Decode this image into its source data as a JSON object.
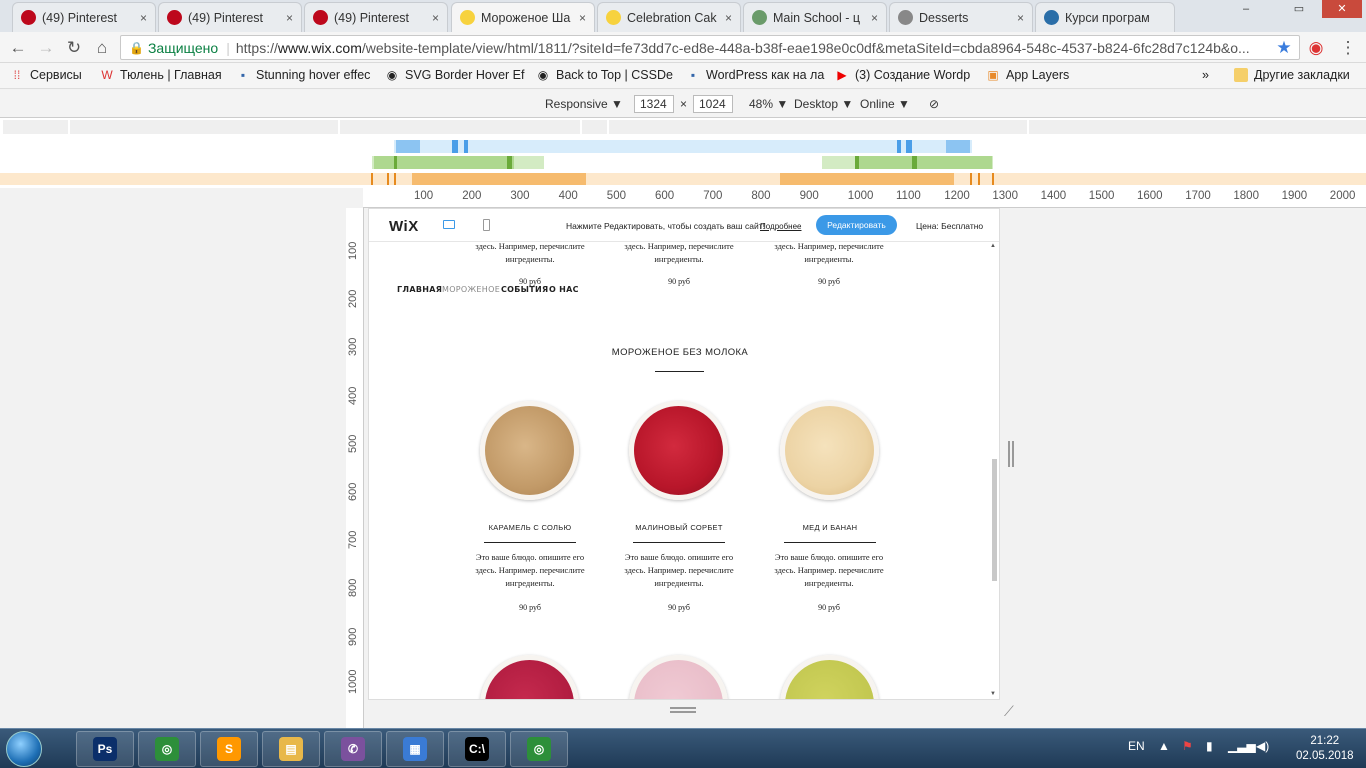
{
  "browser": {
    "tabs": [
      {
        "title": "(49) Pinterest",
        "icon": "pinterest-icon",
        "color": "#bd081c",
        "active": false
      },
      {
        "title": "(49) Pinterest",
        "icon": "pinterest-icon",
        "color": "#bd081c",
        "active": false
      },
      {
        "title": "(49) Pinterest",
        "icon": "pinterest-icon",
        "color": "#bd081c",
        "active": false
      },
      {
        "title": "Мороженое Ша",
        "icon": "wix-icon",
        "color": "#f7d23e",
        "active": true
      },
      {
        "title": "Celebration Cak",
        "icon": "wix-icon",
        "color": "#f7d23e",
        "active": false
      },
      {
        "title": "Main School - ц",
        "icon": "globe-icon",
        "color": "#6a9b6a",
        "active": false
      },
      {
        "title": "Desserts",
        "icon": "page-icon",
        "color": "#888888",
        "active": false
      },
      {
        "title": "Курси програм",
        "icon": "globe-icon",
        "color": "#2a6ea8",
        "active": false
      }
    ],
    "close_glyph": "×",
    "address": {
      "secure_label": "Защищено",
      "url_scheme": "https://",
      "url_host": "www.wix.com",
      "url_path": "/website-template/view/html/1811/?siteId=fe73dd7c-ed8e-448a-b38f-eae198e0c0df&metaSiteId=cbda8964-548c-4537-b824-6fc28d7c124b&o..."
    },
    "bookmarks": [
      {
        "label": "Сервисы",
        "icon": "apps-icon"
      },
      {
        "label": "Тюлень | Главная",
        "icon": "w-icon"
      },
      {
        "label": "Stunning hover effec",
        "icon": "page-icon"
      },
      {
        "label": "SVG Border Hover Ef",
        "icon": "codepen-icon"
      },
      {
        "label": "Back to Top | CSSDe",
        "icon": "codepen-icon"
      },
      {
        "label": "WordPress как на ла",
        "icon": "page-icon"
      },
      {
        "label": "(3) Создание Wordp",
        "icon": "youtube-icon"
      },
      {
        "label": "App Layers",
        "icon": "app-layers-icon"
      }
    ],
    "bookmarks_more": "»",
    "other_bookmarks": "Другие закладки"
  },
  "devtools": {
    "mode": "Responsive",
    "width": "1324",
    "times": "×",
    "height": "1024",
    "zoom": "48%",
    "device": "Desktop",
    "network": "Online",
    "ruler_ticks": [
      "100",
      "200",
      "300",
      "400",
      "500",
      "600",
      "700",
      "800",
      "900",
      "1000",
      "1100",
      "1200",
      "1300",
      "1400",
      "1500",
      "1600",
      "1700",
      "1800",
      "1900",
      "2000"
    ],
    "vruler_ticks": [
      "100",
      "200",
      "300",
      "400",
      "500",
      "600",
      "700",
      "800",
      "900",
      "1000"
    ]
  },
  "wix": {
    "logo": "WiX",
    "message": "Нажмите Редактировать, чтобы создать ваш сайт!",
    "more": "Подробнее",
    "edit_button": "Редактировать",
    "price": "Цена: Бесплатно"
  },
  "site": {
    "nav": [
      "ГЛАВНАЯ",
      "МОРОЖЕНОЕ",
      "СОБЫТИЯ",
      "О НАС"
    ],
    "top_captions": [
      "здесь. Например, перечислите ингредиенты.",
      "здесь. Например, перечислите ингредиенты.",
      "здесь. Например, перечислите ингредиенты."
    ],
    "top_prices": [
      "90 руб",
      "90 руб",
      "90 руб"
    ],
    "section_title": "МОРОЖЕНОЕ БЕЗ МОЛОКА",
    "products": [
      {
        "name": "КАРАМЕЛЬ С СОЛЬЮ",
        "desc": "Это ваше блюдо. опишите его здесь. Например. перечислите ингредиенты.",
        "price": "90 руб",
        "color": "#c9a373"
      },
      {
        "name": "МАЛИНОВЫЙ СОРБЕТ",
        "desc": "Это ваше блюдо. опишите его здесь. Например. перечислите ингредиенты.",
        "price": "90 руб",
        "color": "#b8162a"
      },
      {
        "name": "МЕД И БАНАН",
        "desc": "Это ваше блюдо. опишите его здесь. Например. перечислите ингредиенты.",
        "price": "90 руб",
        "color": "#ecd3a4"
      }
    ],
    "next_row_colors": [
      "#a8163a",
      "#e6b8c4",
      "#bcc24a"
    ]
  },
  "taskbar": {
    "apps": [
      "ie-icon",
      "photoshop-icon",
      "chrome-icon",
      "sublime-icon",
      "explorer-icon",
      "viber-icon",
      "control-panel-icon",
      "cmd-icon",
      "chrome-icon"
    ],
    "lang": "EN",
    "time": "21:22",
    "date": "02.05.2018"
  }
}
